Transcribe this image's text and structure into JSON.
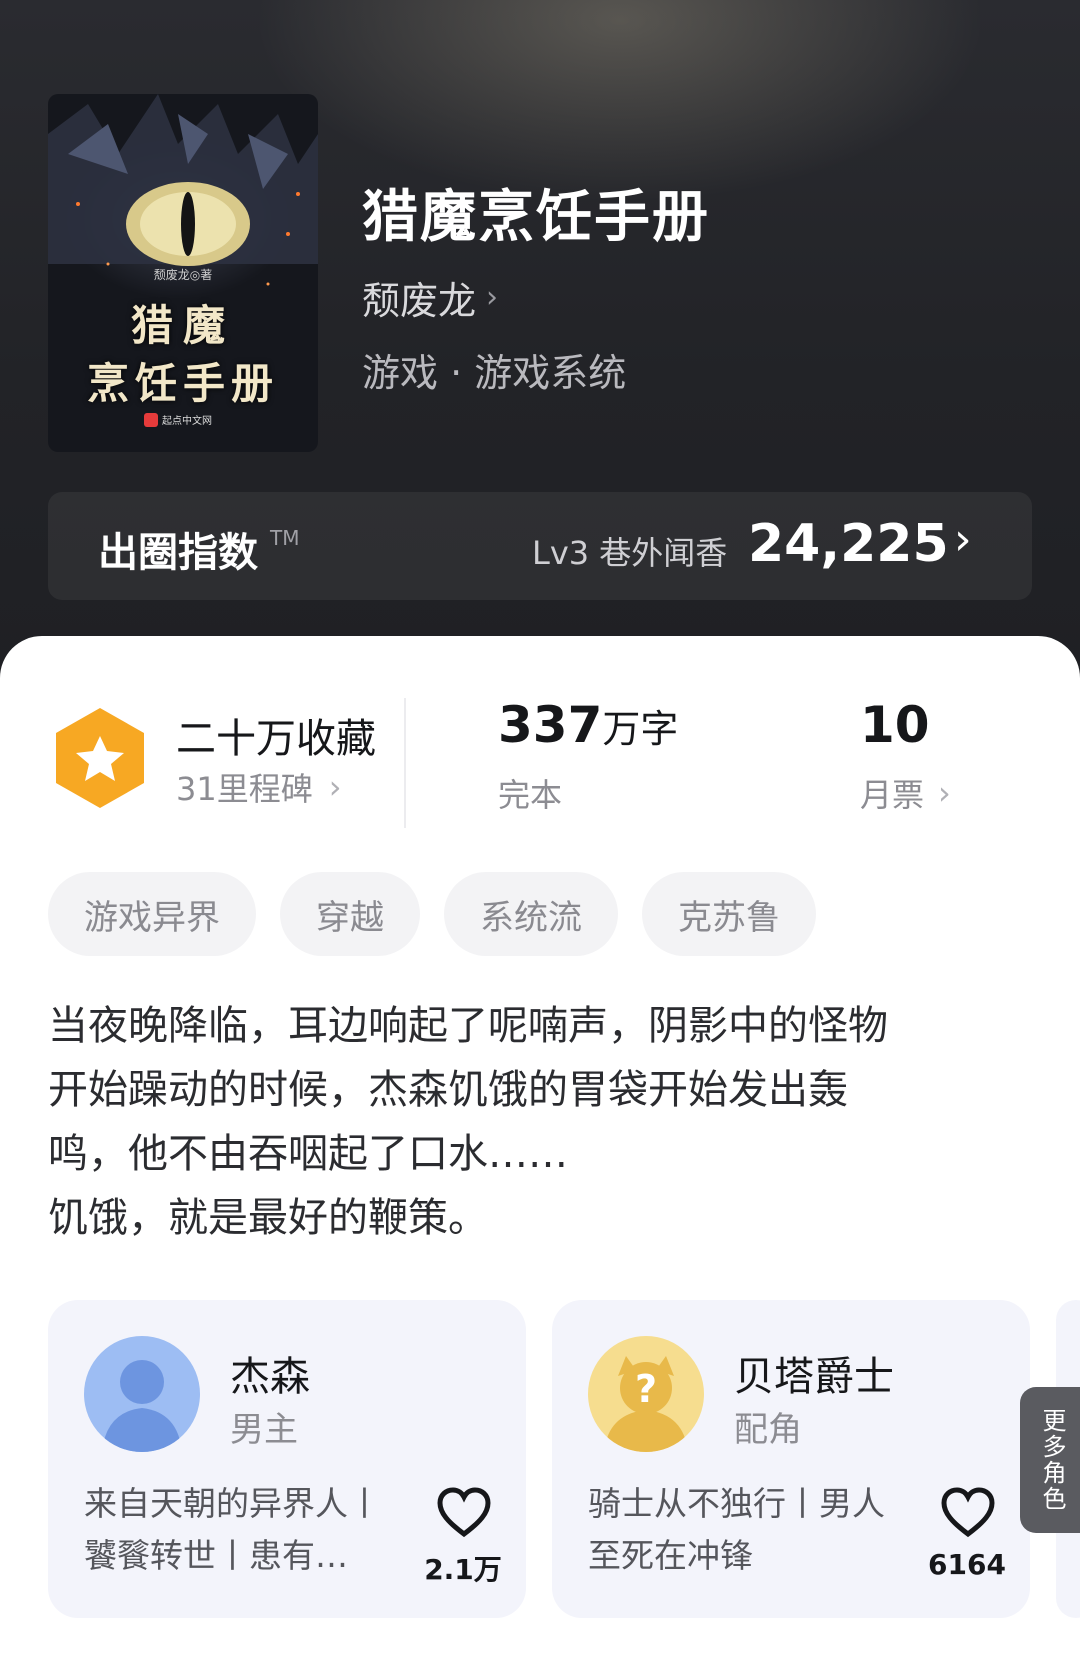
{
  "book": {
    "cover_author": "颓废龙◎著",
    "cover_title_line1": "猎魔",
    "cover_title_line2": "烹饪手册",
    "cover_publisher": "起点中文网",
    "title": "猎魔烹饪手册",
    "author": "颓废龙",
    "category": "游戏 · 游戏系统"
  },
  "breakout_index": {
    "label": "出圈指数",
    "tm": "TM",
    "level": "Lv3 巷外闻香",
    "value": "24,225"
  },
  "stats": {
    "favorites": "二十万收藏",
    "milestones": "31里程碑",
    "word_count_number": "337",
    "word_count_unit": "万字",
    "status": "完本",
    "monthly_tickets": "10",
    "monthly_tickets_label": "月票"
  },
  "tags": [
    "游戏异界",
    "穿越",
    "系统流",
    "克苏鲁"
  ],
  "synopsis": {
    "line1": "当夜晚降临，耳边响起了呢喃声，阴影中的怪物",
    "line2": "开始躁动的时候，杰森饥饿的胃袋开始发出轰",
    "line3": "鸣，他不由吞咽起了口水……",
    "line4": "饥饿，就是最好的鞭策。"
  },
  "characters": [
    {
      "name": "杰森",
      "role": "男主",
      "desc": "来自天朝的异界人丨饕餮转世丨患有…",
      "likes": "2.1万"
    },
    {
      "name": "贝塔爵士",
      "role": "配角",
      "desc": "骑士从不独行丨男人至死在冲锋",
      "likes": "6164"
    }
  ],
  "more_characters": "更多角色",
  "colors": {
    "accent_hex": "#f7a823",
    "heart": "#16171a",
    "avatar_blue": "#8ab0ee",
    "avatar_gold": "#f4d37a"
  },
  "icons": {
    "star_badge": "star-hexagon-icon",
    "heart": "heart-icon",
    "chevron": "chevron-right-icon"
  }
}
